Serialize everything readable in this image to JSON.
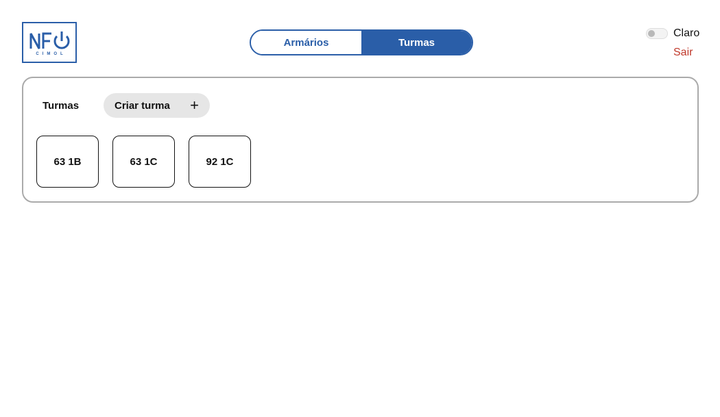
{
  "header": {
    "logo": {
      "text": "NFO",
      "subtitle": "CIMOL"
    },
    "tabs": [
      {
        "label": "Armários",
        "active": false
      },
      {
        "label": "Turmas",
        "active": true
      }
    ],
    "theme_label": "Claro",
    "logout_label": "Sair"
  },
  "panel": {
    "title": "Turmas",
    "create_label": "Criar turma",
    "create_icon": "+",
    "classes": [
      "63 1B",
      "63 1C",
      "92 1C"
    ]
  },
  "colors": {
    "accent": "#2a5ea8",
    "logout": "#c0392b",
    "button_bg": "#e6e6e6"
  }
}
